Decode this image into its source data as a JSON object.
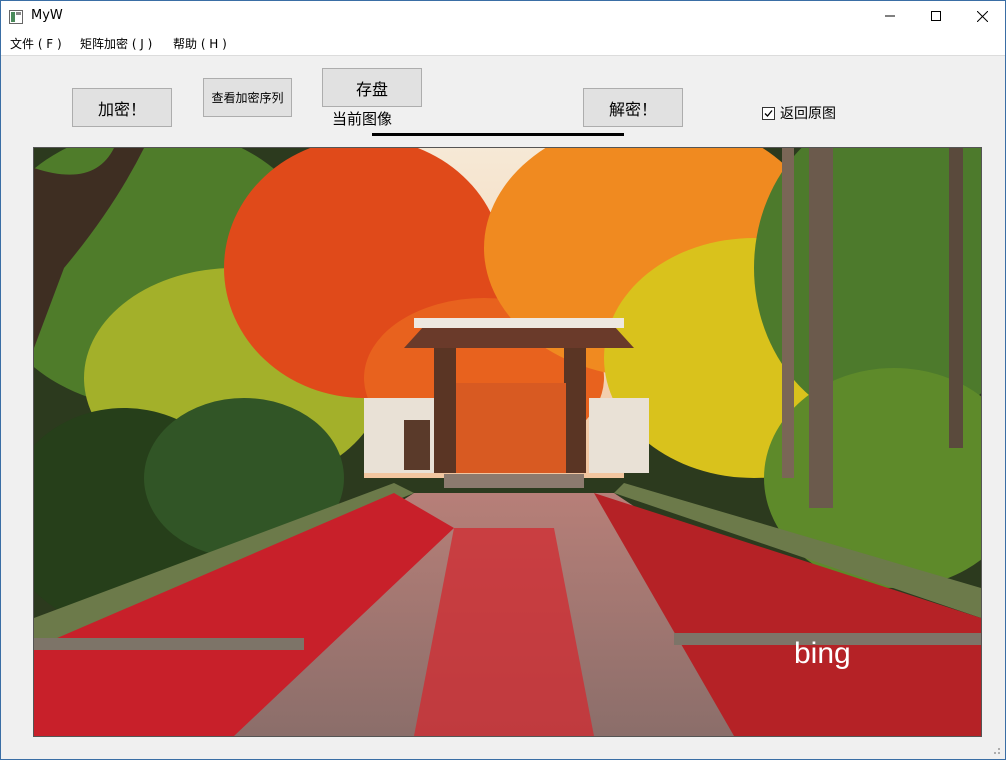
{
  "window": {
    "title": "MyW"
  },
  "menu": {
    "items": [
      {
        "label": "文件 ( F )"
      },
      {
        "label": "矩阵加密 ( J )"
      },
      {
        "label": "帮助 ( H )"
      }
    ]
  },
  "toolbar": {
    "encrypt_label": "加密！",
    "view_sequence_label": "查看加密序列",
    "save_label": "存盘",
    "current_image_label": "当前图像",
    "decrypt_label": "解密！",
    "restore_label": "返回原图",
    "restore_checked": true
  },
  "photo": {
    "watermark": "bing"
  },
  "colors": {
    "title_bar": "#ffffff",
    "window_border": "#3a6ea5",
    "button_bg": "#e1e1e1",
    "button_border": "#adadad"
  }
}
